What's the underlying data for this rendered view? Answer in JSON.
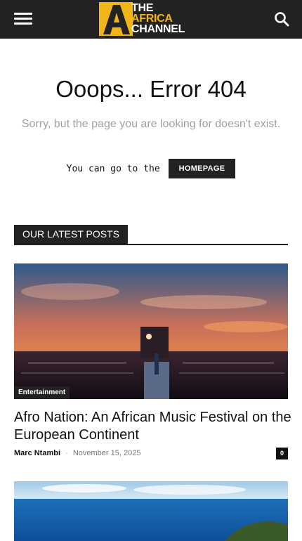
{
  "header": {
    "logo_text": {
      "line1": "THE",
      "line2": "AFRICA",
      "line3": "CHANNEL"
    },
    "menu_icon": "hamburger-menu-icon",
    "search_icon": "search-icon",
    "bg_color": "#222222",
    "brand_color": "#f2b517"
  },
  "error": {
    "title": "Ooops... Error 404",
    "subtitle": "Sorry, but the page you are looking for doesn't exist.",
    "goto_text": "You can go to the",
    "homepage_label": "HOMEPAGE"
  },
  "latest": {
    "section_label": "OUR LATEST POSTS",
    "posts": [
      {
        "category": "Entertainment",
        "title": "Afro Nation: An African Music Festival on the European Continent",
        "author": "Marc Ntambi",
        "separator": "-",
        "date": "November 15, 2025",
        "comments": "0"
      }
    ]
  }
}
